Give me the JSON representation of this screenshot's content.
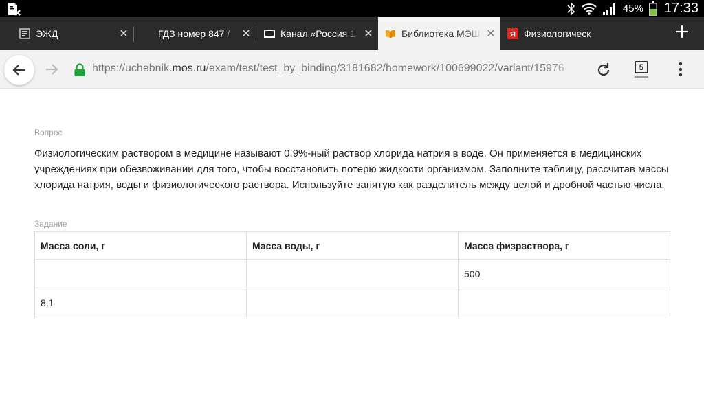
{
  "status_bar": {
    "battery": "45%",
    "time": "17:33",
    "icons": [
      "notification-icon",
      "bluetooth-icon",
      "wifi-icon",
      "signal-icon",
      "battery-icon"
    ]
  },
  "tabs": [
    {
      "title": "ЭЖД",
      "icon": "document-favicon",
      "active": false
    },
    {
      "title": "ГДЗ номер 847 / ",
      "icon": "none",
      "active": false
    },
    {
      "title": "Канал «Россия 1",
      "icon": "tv-favicon",
      "active": false
    },
    {
      "title": "Библиотека МЭШ",
      "icon": "book-favicon",
      "active": true
    },
    {
      "title": "Физиологическ",
      "icon": "yandex-favicon",
      "active": false
    }
  ],
  "toolbar": {
    "url_prefix": "https://uchebnik.",
    "url_domain": "mos.ru",
    "url_path": "/exam/test/test_by_binding/3181682/homework/100699022/variant/15976",
    "tab_count": "5"
  },
  "colors": {
    "accent_green": "#1ea33a",
    "tab_strip": "#2b2b2b",
    "active_tab": "#f2f2f2"
  },
  "content": {
    "question_label": "Вопрос",
    "question_text": "Физиологическим раствором в медицине называют 0,9%-ный раствор хлорида натрия в воде. Он применяется в медицинских учреждениях при обезвоживании для того, чтобы восстановить потерю жидкости организмом. Заполните таблицу, рассчитав массы хлорида натрия, воды и физиологического раствора. Используйте запятую как разделитель между целой и дробной частью числа.",
    "task_label": "Задание",
    "table": {
      "headers": [
        "Масса соли, г",
        "Масса воды, г",
        "Масса физраствора, г"
      ],
      "rows": [
        [
          "",
          "",
          "500"
        ],
        [
          "8,1",
          "",
          ""
        ]
      ]
    }
  }
}
